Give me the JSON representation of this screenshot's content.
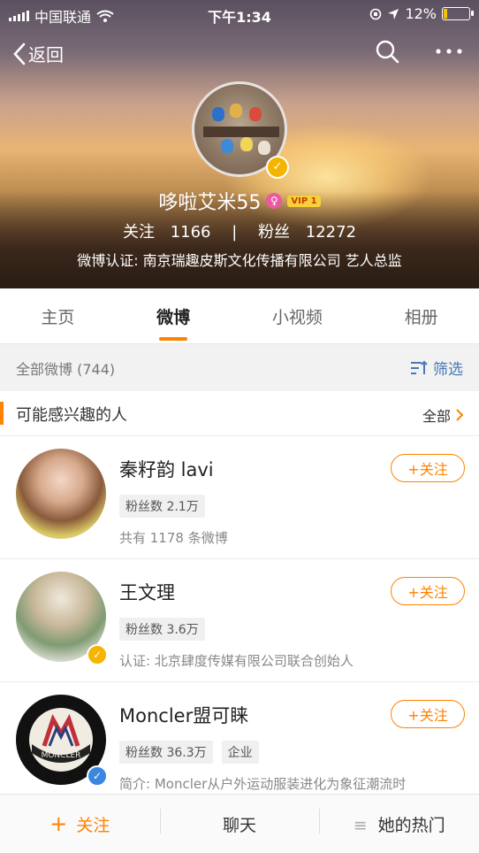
{
  "status_bar": {
    "carrier": "中国联通",
    "time": "下午1:34",
    "battery": "12%"
  },
  "nav": {
    "back_label": "返回"
  },
  "profile": {
    "name": "哆啦艾米55",
    "vip": "VIP 1",
    "following_label": "关注",
    "following_count": "1166",
    "separator": "|",
    "fans_label": "粉丝",
    "fans_count": "12272",
    "certification": "微博认证: 南京瑞趣皮斯文化传播有限公司 艺人总监"
  },
  "tabs": [
    "主页",
    "微博",
    "小视频",
    "相册"
  ],
  "filter": {
    "count_label": "全部微博 (744)",
    "filter_label": "筛选"
  },
  "recommend": {
    "title": "可能感兴趣的人",
    "all_label": "全部"
  },
  "cards": [
    {
      "name": "秦籽韵 lavi",
      "tags": [
        "粉丝数 2.1万"
      ],
      "desc": "共有 1178 条微博",
      "follow": "+关注"
    },
    {
      "name": "王文理",
      "tags": [
        "粉丝数 3.6万"
      ],
      "desc": "认证: 北京肆度传媒有限公司联合创始人",
      "follow": "+关注"
    },
    {
      "name": "Moncler盟可睐",
      "tags": [
        "粉丝数 36.3万",
        "企业"
      ],
      "desc": "简介: Moncler从户外运动服装进化为象征潮流时",
      "follow": "+关注",
      "logo_text": "MONCLER"
    }
  ],
  "bottom_bar": {
    "follow": "关注",
    "chat": "聊天",
    "hot": "她的热门"
  }
}
